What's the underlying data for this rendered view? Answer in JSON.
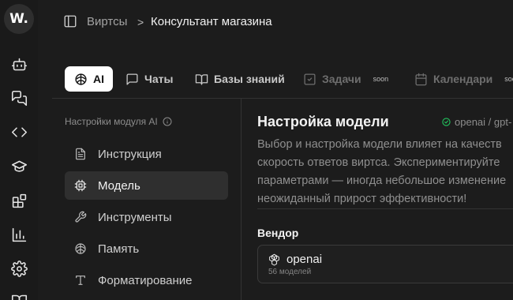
{
  "app": {
    "logo_text": "W."
  },
  "rail": {
    "items": [
      {
        "icon": "bot-icon"
      },
      {
        "icon": "chat-icon"
      },
      {
        "icon": "code-icon"
      },
      {
        "icon": "graduation-cap-icon"
      },
      {
        "icon": "blocks-icon"
      },
      {
        "icon": "bar-chart-icon"
      },
      {
        "icon": "gear-icon"
      },
      {
        "icon": "book-icon"
      }
    ]
  },
  "breadcrumb": {
    "root": "Виртсы",
    "separator": ">",
    "current": "Консультант магазина"
  },
  "tabs": [
    {
      "label": "AI",
      "icon": "brain-icon",
      "active": true,
      "soon": ""
    },
    {
      "label": "Чаты",
      "icon": "message-square-icon",
      "active": false,
      "soon": ""
    },
    {
      "label": "Базы знаний",
      "icon": "book-open-icon",
      "active": false,
      "soon": ""
    },
    {
      "label": "Задачи",
      "icon": "checkbox-icon",
      "active": false,
      "soon": "soon"
    },
    {
      "label": "Календари",
      "icon": "calendar-icon",
      "active": false,
      "soon": "soon"
    }
  ],
  "settings_nav": {
    "title": "Настройки модуля AI",
    "items": [
      {
        "label": "Инструкция",
        "icon": "document-icon",
        "active": false
      },
      {
        "label": "Модель",
        "icon": "cpu-icon",
        "active": true
      },
      {
        "label": "Инструменты",
        "icon": "wrench-icon",
        "active": false
      },
      {
        "label": "Память",
        "icon": "brain-icon",
        "active": false
      },
      {
        "label": "Форматирование",
        "icon": "type-icon",
        "active": false
      }
    ]
  },
  "model_settings": {
    "title": "Настройка модели",
    "current_model": "openai / gpt-",
    "description_lines": [
      "Выбор и настройка модели влияет на качеств",
      "скорость ответов виртса. Экспериментируйте",
      "параметрами — иногда небольшое изменение",
      "неожиданный прирост эффективности!"
    ],
    "vendor_label": "Вендор",
    "vendor": {
      "name": "openai",
      "models_count": "56 моделей"
    }
  },
  "colors": {
    "background": "#1c1c1c",
    "accent_active_tab": "#ffffff",
    "status_green": "#22c55e"
  }
}
